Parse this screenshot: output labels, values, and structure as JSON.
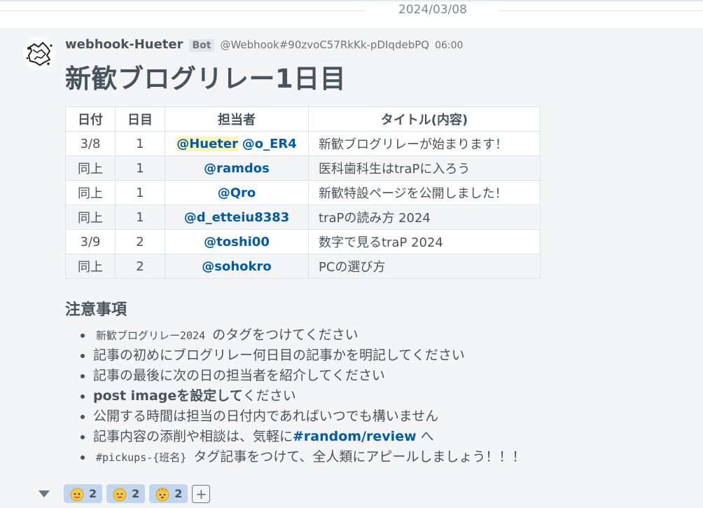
{
  "date_separator": "2024/03/08",
  "message": {
    "author": "webhook-Hueter",
    "bot_tag": "Bot",
    "handle": "@Webhook#90zvoC57RkKk-pDIqdebPQ",
    "time": "06:00",
    "title": "新歓ブログリレー1日目",
    "table": {
      "headers": [
        "日付",
        "日目",
        "担当者",
        "タイトル(内容)"
      ],
      "rows": [
        {
          "date": "3/8",
          "day": "1",
          "who": [
            "@Hueter",
            "@o_ER4"
          ],
          "title": "新歓ブログリレーが始まります！"
        },
        {
          "date": "同上",
          "day": "1",
          "who": [
            "@ramdos"
          ],
          "title": "医科歯科生はtraPに入ろう"
        },
        {
          "date": "同上",
          "day": "1",
          "who": [
            "@Qro"
          ],
          "title": "新歓特設ページを公開しました！"
        },
        {
          "date": "同上",
          "day": "1",
          "who": [
            "@d_etteiu8383"
          ],
          "title": "traPの読み方 2024"
        },
        {
          "date": "3/9",
          "day": "2",
          "who": [
            "@toshi00"
          ],
          "title": "数字で見るtraP 2024"
        },
        {
          "date": "同上",
          "day": "2",
          "who": [
            "@sohokro"
          ],
          "title": "PCの選び方"
        }
      ]
    },
    "notes_heading": "注意事項",
    "notes": {
      "n1_code": "新歓ブログリレー2024",
      "n1_text": " のタグをつけてください",
      "n2": "記事の初めにブログリレー何日目の記事かを明記してください",
      "n3": "記事の最後に次の日の担当者を紹介してください",
      "n4_bold": "post imageを設定して",
      "n4_text": "ください",
      "n5": "公開する時間は担当の日付内であればいつでも構いません",
      "n6_pre": "記事内容の添削や相談は、気軽に",
      "n6_channel": "#random/review",
      "n6_post": " へ",
      "n7_code": "#pickups-{班名}",
      "n7_text": " タグ記事をつけて、全人類にアピールしましょう！！！"
    },
    "stamps": [
      {
        "icon": "yellow-face-stamp-icon",
        "count": "2"
      },
      {
        "icon": "yellow-face-stamp-icon",
        "count": "2"
      },
      {
        "icon": "yellow-face-stamp-icon",
        "count": "2"
      }
    ],
    "add_stamp_label": "+"
  },
  "colors": {
    "accent": "#005bac",
    "stamp_bg": "#bfd6ee",
    "message_bg": "#f4f5f7",
    "mention_highlight": "#fff6b3"
  }
}
